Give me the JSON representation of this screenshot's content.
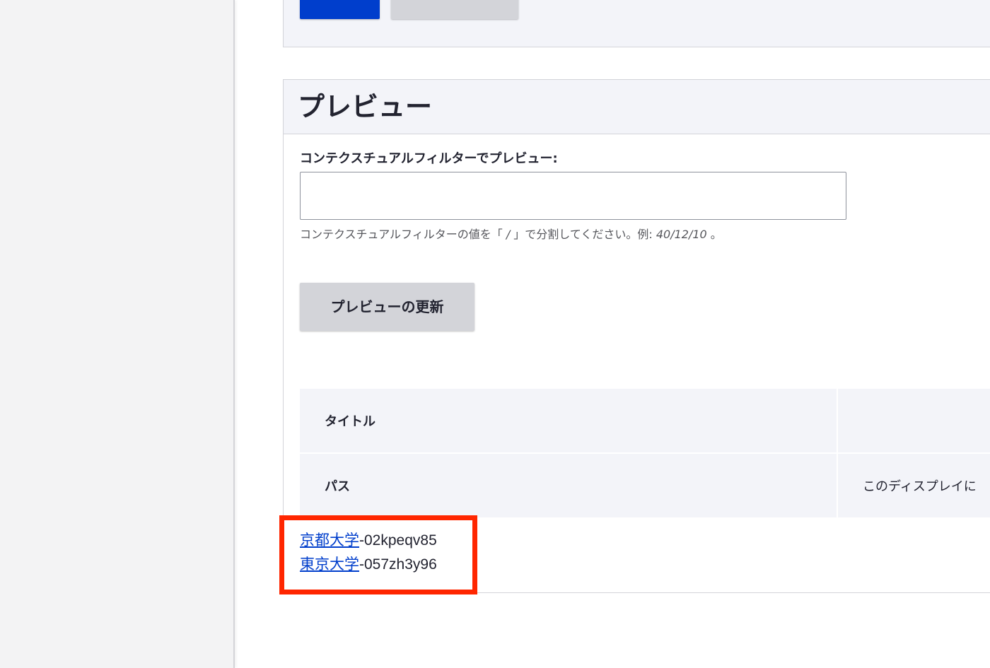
{
  "top_actions": {
    "save_label": "",
    "cancel_label": ""
  },
  "preview": {
    "title": "プレビュー",
    "contextual_filter_label": "コンテクスチュアルフィルターでプレビュー:",
    "contextual_filter_value": "",
    "help_text_prefix": "コンテクスチュアルフィルターの値を「",
    "help_separator": " / ",
    "help_text_middle": "」で分割してください。例: ",
    "help_example": "40/12/10",
    "help_text_suffix": " 。",
    "update_button_label": "プレビューの更新"
  },
  "info_table": {
    "rows": [
      {
        "label": "タイトル",
        "value": ""
      },
      {
        "label": "パス",
        "value": "このディスプレイに"
      }
    ]
  },
  "results": [
    {
      "link_text": "京都大学",
      "suffix": "-02kpeqv85"
    },
    {
      "link_text": "東京大学",
      "suffix": "-057zh3y96"
    }
  ],
  "colors": {
    "primary": "#003ecc",
    "highlight": "#ff2600"
  }
}
